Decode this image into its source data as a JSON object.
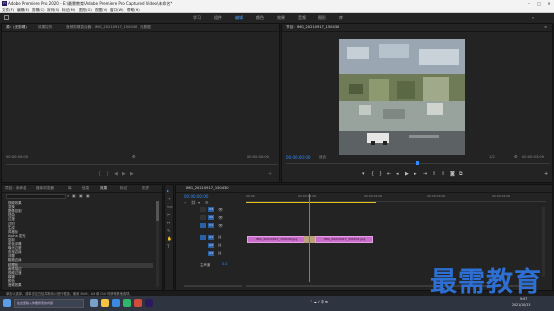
{
  "window": {
    "title": "Adobe Premiere Pro 2020 - E:\\最需教育\\Adobe Premiere Pro Captured Video\\未命名*"
  },
  "menu": [
    "文件(F)",
    "编辑(E)",
    "剪辑(C)",
    "序列(S)",
    "标记(M)",
    "图形(G)",
    "视图(V)",
    "窗口(W)",
    "帮助(H)"
  ],
  "workspaces": [
    {
      "label": "学习",
      "active": false
    },
    {
      "label": "组件",
      "active": false
    },
    {
      "label": "编辑",
      "active": true
    },
    {
      "label": "颜色",
      "active": false
    },
    {
      "label": "效果",
      "active": false
    },
    {
      "label": "音频",
      "active": false
    },
    {
      "label": "图形",
      "active": false
    },
    {
      "label": "库",
      "active": false
    }
  ],
  "source_panel": {
    "tabs": [
      "源：(无剪辑)",
      "效果控件",
      "音频剪辑混合器：IMG_20210917_150430",
      "元数据"
    ],
    "timecode_left": "00:00:00:00",
    "timecode_right": "00:00:00:00"
  },
  "program_panel": {
    "tab": "节目：IMG_20210917_150430",
    "timecode": "00:00:00:00",
    "fit": "适合",
    "quality": "1/2",
    "duration": "00:00:03:09"
  },
  "project_panel": {
    "tabs": [
      "项目：未命名",
      "媒体浏览器",
      "库",
      "信息",
      "效果",
      "标记",
      "历史"
    ],
    "tree": [
      {
        "label": "视频效果",
        "selected": false
      },
      {
        "label": "变换",
        "selected": false
      },
      {
        "label": "图像控制",
        "selected": false
      },
      {
        "label": "扭曲",
        "selected": false
      },
      {
        "label": "过渡",
        "selected": false
      },
      {
        "label": "过时",
        "selected": false
      },
      {
        "label": "生成",
        "selected": false
      },
      {
        "label": "风格化",
        "selected": false
      },
      {
        "label": "Alpha 发光",
        "selected": false
      },
      {
        "label": "复制",
        "selected": false
      },
      {
        "label": "彩色浮雕",
        "selected": false
      },
      {
        "label": "曝光过度",
        "selected": false
      },
      {
        "label": "查找边缘",
        "selected": false
      },
      {
        "label": "浮雕",
        "selected": false
      },
      {
        "label": "粗糙边缘",
        "selected": false
      },
      {
        "label": "纹理化",
        "selected": true
      },
      {
        "label": "画笔描边",
        "selected": false
      },
      {
        "label": "视频过渡",
        "selected": false
      },
      {
        "label": "模糊",
        "selected": false
      },
      {
        "label": "颜色",
        "selected": false
      },
      {
        "label": "音频效果",
        "selected": false
      }
    ]
  },
  "timeline": {
    "tab": "IMG_20210917_150430",
    "timecode": "00:00:00:00",
    "ruler": [
      "00:00",
      "00:00:01:00",
      "00:00:02:00",
      "00:00:03:00",
      "00:00:04:00"
    ],
    "tracks_video": [
      "V3",
      "V2",
      "V1"
    ],
    "tracks_audio": [
      "A1",
      "A2",
      "A3"
    ],
    "master_label": "主声道",
    "master_value": "0.0",
    "clip1": "IMG_20210917_150430.jpg",
    "clip2": "IMG_20210917_150431.jpg"
  },
  "status_text": "单击以选择，或单击空白处并拖动以进行框选。使用 Shift、Alt 和 Ctrl 可获得其他选项。",
  "taskbar": {
    "search_placeholder": "在这里输入你要搜索的内容",
    "time": "9:07",
    "date": "2021/10/13"
  },
  "watermark": "最需教育",
  "colors": {
    "accent": "#2f8cff",
    "clip": "#c86ec9",
    "watermark": "#2d6fd3"
  }
}
